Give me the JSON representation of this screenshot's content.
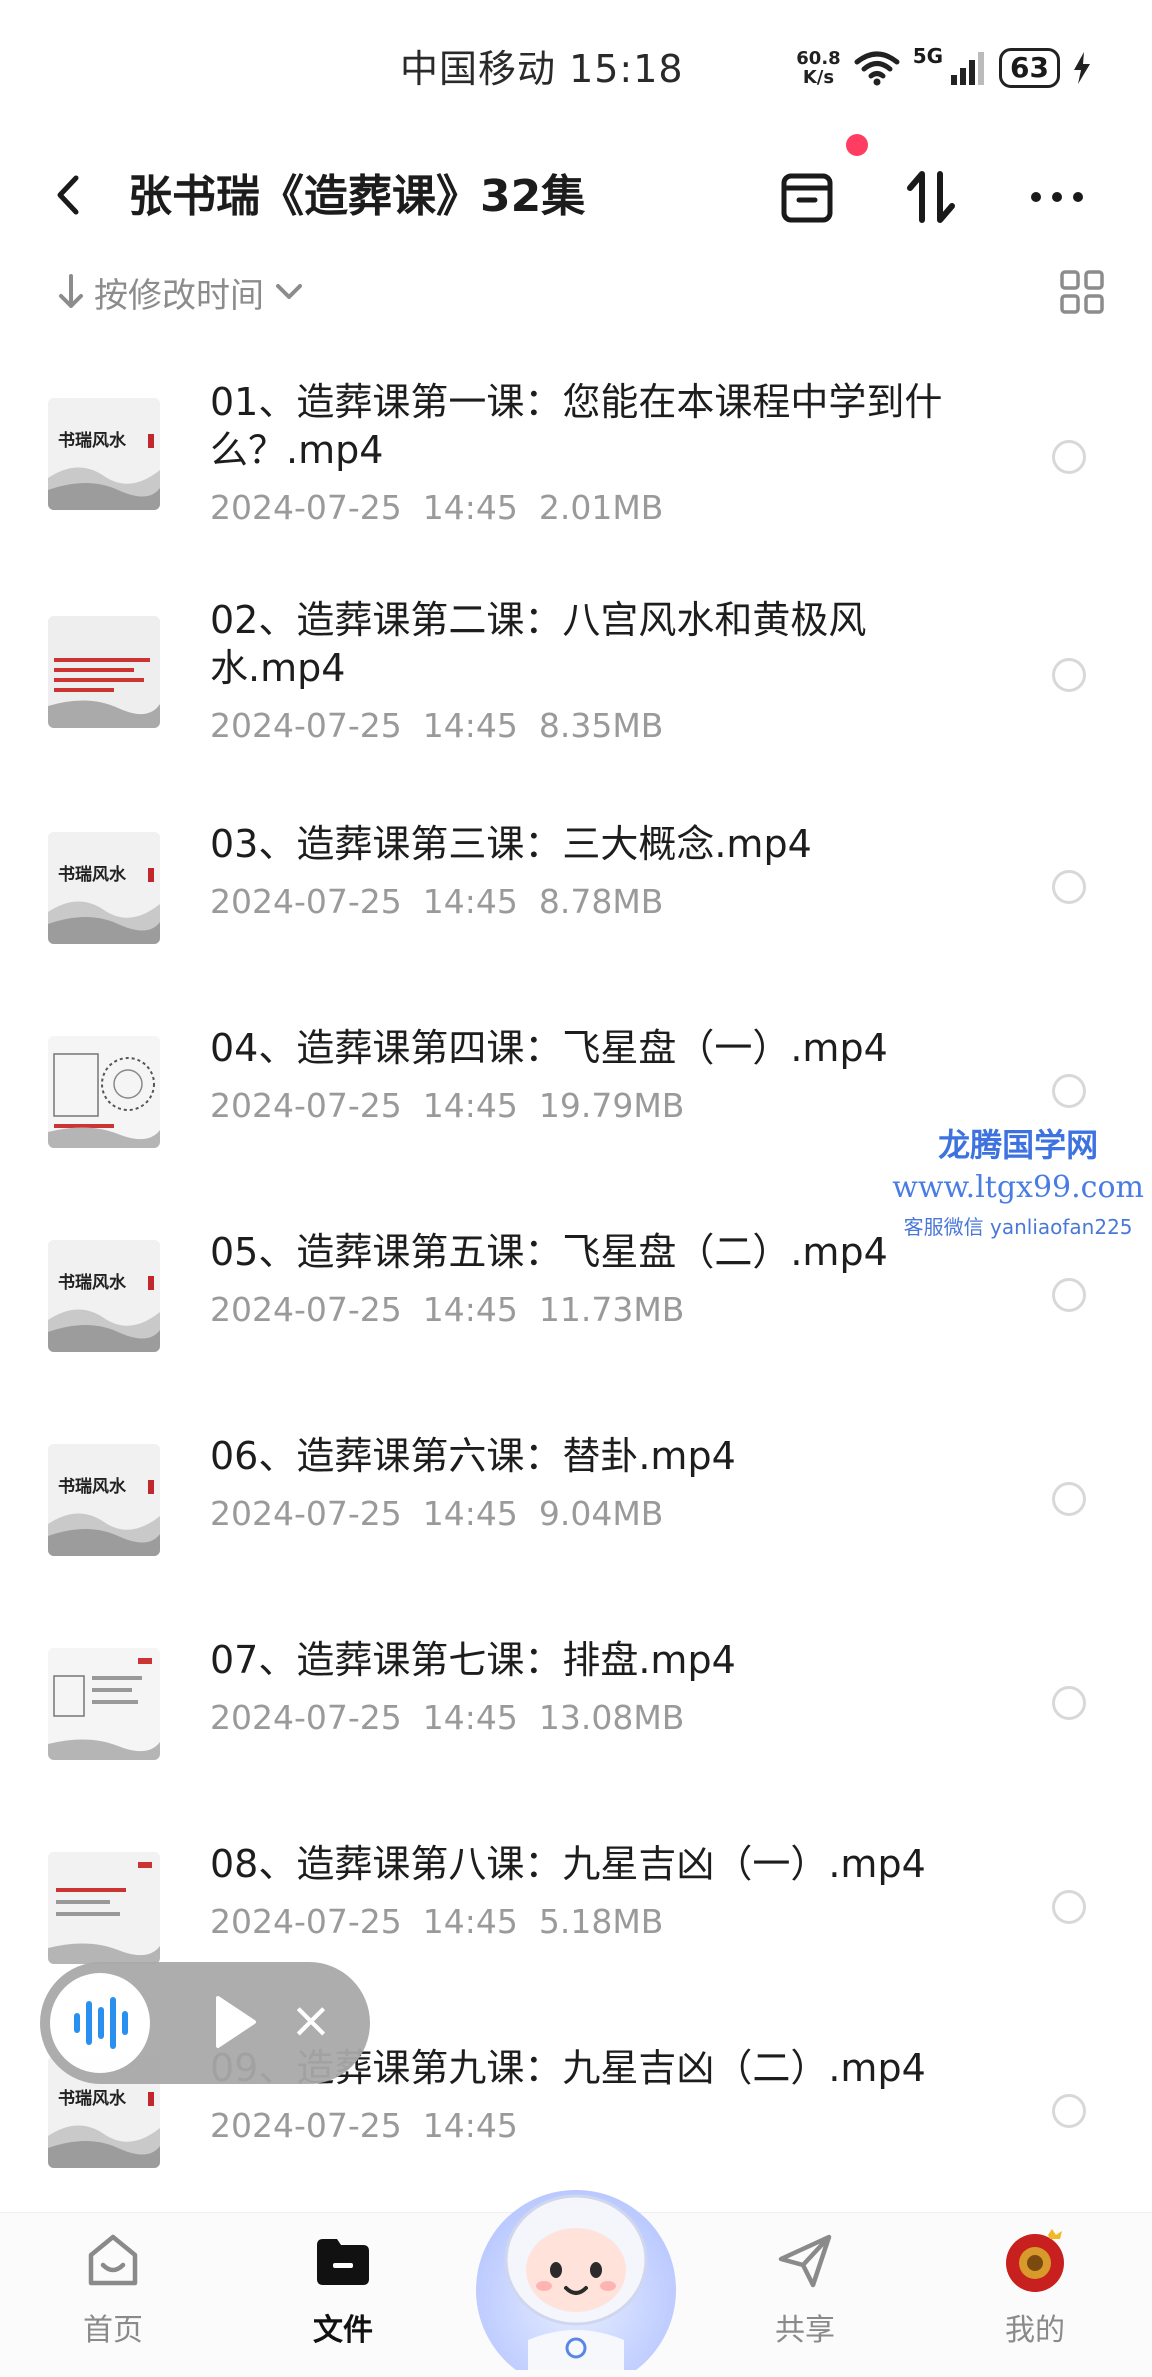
{
  "status_bar": {
    "carrier_time": "中国移动 15:18",
    "speed": "60.8",
    "speed_unit": "K/s",
    "network": "5G",
    "battery": "63"
  },
  "header": {
    "title": "张书瑞《造葬课》32集"
  },
  "sort": {
    "label": "按修改时间"
  },
  "files": [
    {
      "name": "01、造葬课第一课：您能在本课程中学到什么？.mp4",
      "date": "2024-07-25",
      "time": "14:45",
      "size": "2.01MB"
    },
    {
      "name": "02、造葬课第二课：八宫风水和黄极风水.mp4",
      "date": "2024-07-25",
      "time": "14:45",
      "size": "8.35MB"
    },
    {
      "name": "03、造葬课第三课：三大概念.mp4",
      "date": "2024-07-25",
      "time": "14:45",
      "size": "8.78MB"
    },
    {
      "name": "04、造葬课第四课：飞星盘（一）.mp4",
      "date": "2024-07-25",
      "time": "14:45",
      "size": "19.79MB"
    },
    {
      "name": "05、造葬课第五课：飞星盘（二）.mp4",
      "date": "2024-07-25",
      "time": "14:45",
      "size": "11.73MB"
    },
    {
      "name": "06、造葬课第六课：替卦.mp4",
      "date": "2024-07-25",
      "time": "14:45",
      "size": "9.04MB"
    },
    {
      "name": "07、造葬课第七课：排盘.mp4",
      "date": "2024-07-25",
      "time": "14:45",
      "size": "13.08MB"
    },
    {
      "name": "08、造葬课第八课：九星吉凶（一）.mp4",
      "date": "2024-07-25",
      "time": "14:45",
      "size": "5.18MB"
    },
    {
      "name": "09、造葬课第九课：九星吉凶（二）.mp4",
      "date": "2024-07-25",
      "time": "14:45",
      "size": ""
    }
  ],
  "thumb_text": "书瑞风水",
  "watermark": {
    "line1": "龙腾国学网",
    "line2": "www.ltgx99.com",
    "line3": "客服微信 yanliaofan225"
  },
  "nav": {
    "home": "首页",
    "files": "文件",
    "share": "共享",
    "mine": "我的"
  },
  "colors": {
    "accent_red": "#ff3d62",
    "player_blue": "#1f8bf0",
    "watermark_blue": "#3d72e0"
  }
}
